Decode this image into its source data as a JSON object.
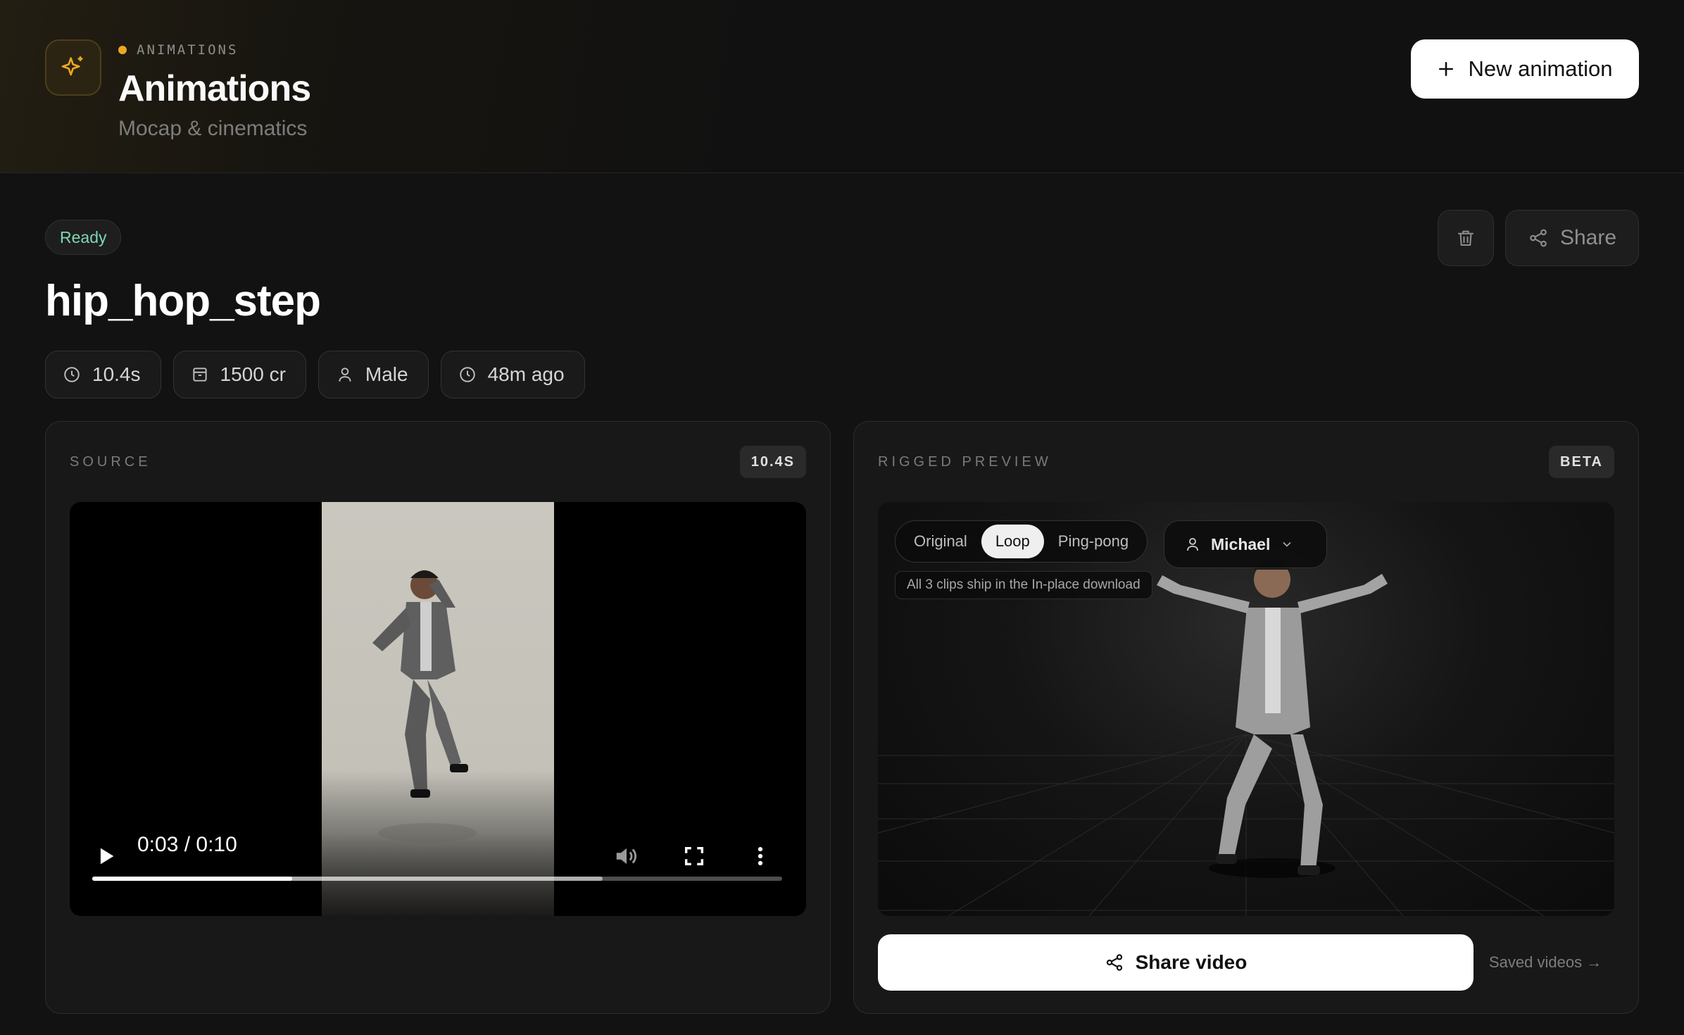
{
  "header": {
    "eyebrow": "ANIMATIONS",
    "title": "Animations",
    "subtitle": "Mocap & cinematics",
    "new_button_label": "New animation",
    "logo_icon": "sparkles-icon",
    "accent_color": "#e9a823"
  },
  "animation": {
    "status": "Ready",
    "name": "hip_hop_step",
    "share_label": "Share",
    "meta": {
      "duration": "10.4s",
      "credits": "1500 cr",
      "gender": "Male",
      "created": "48m ago"
    }
  },
  "source": {
    "label": "SOURCE",
    "badge": "10.4S",
    "player": {
      "time": "0:03 / 0:10",
      "played_fraction": 0.29,
      "buffered_fraction": 0.74
    }
  },
  "rigged": {
    "label": "RIGGED PREVIEW",
    "badge": "BETA",
    "modes": [
      "Original",
      "Loop",
      "Ping-pong"
    ],
    "active_mode": "Loop",
    "character": "Michael",
    "clip_note": "All 3 clips ship in the In-place download",
    "share_video_label": "Share video",
    "saved_videos_label": "Saved videos →"
  }
}
